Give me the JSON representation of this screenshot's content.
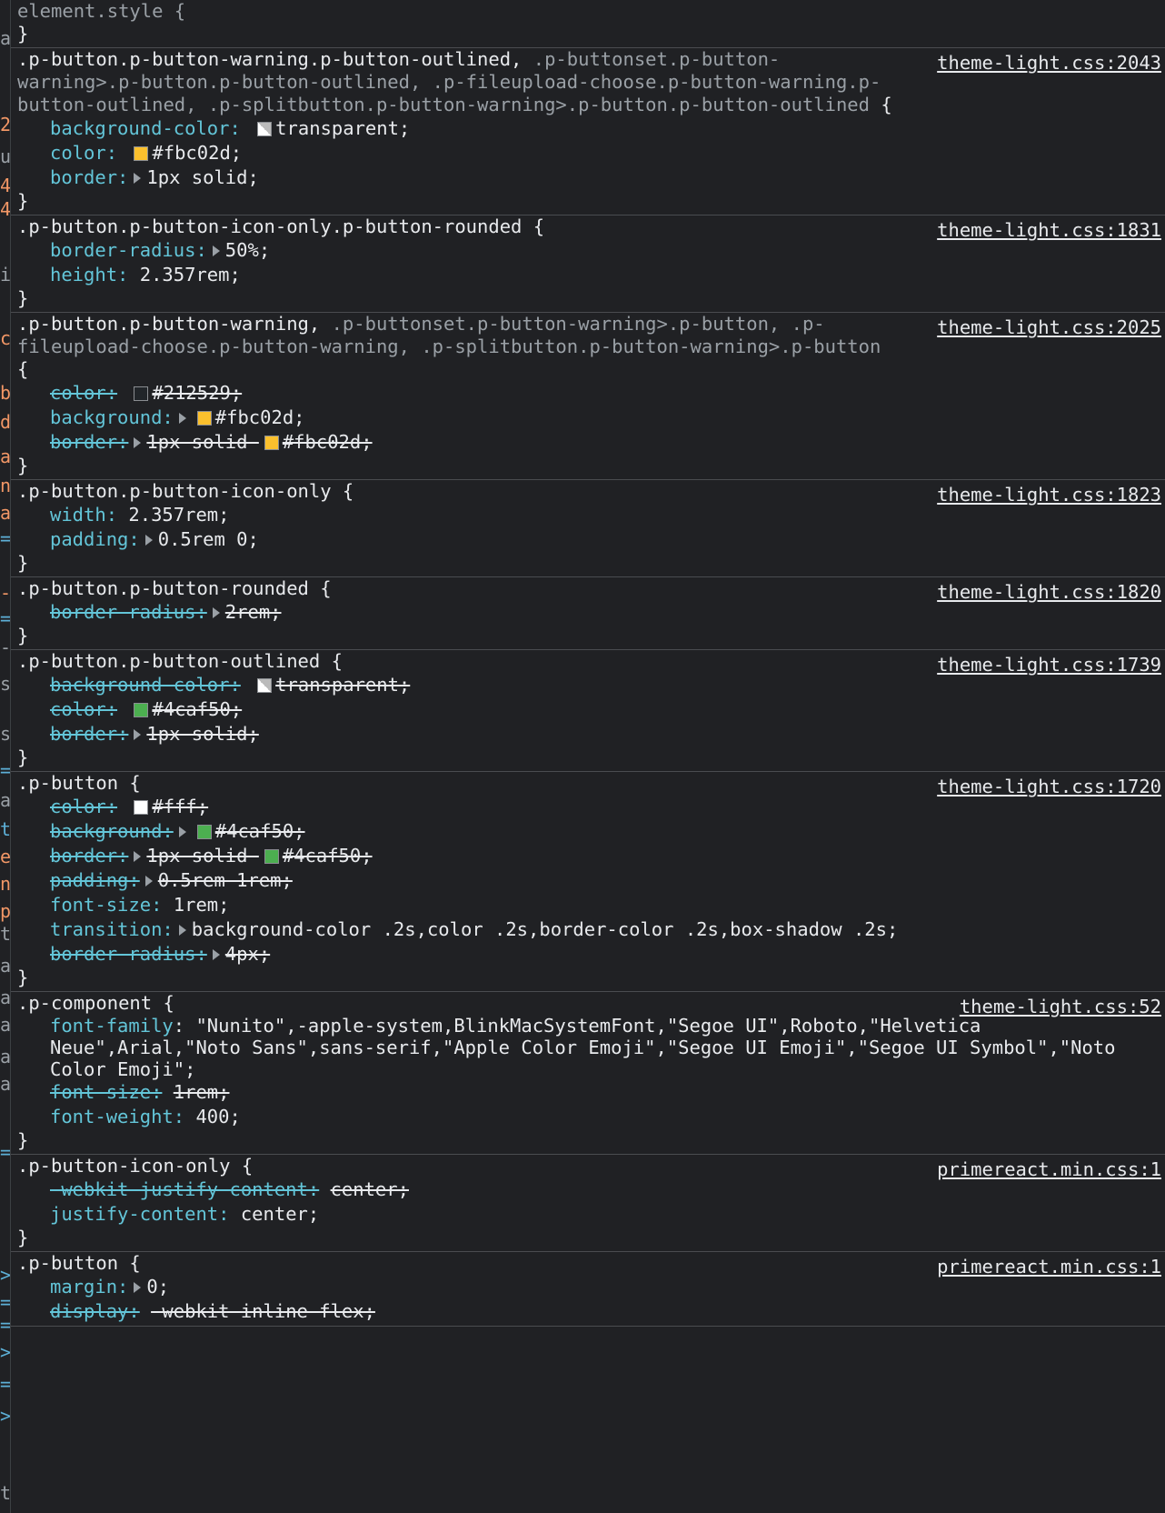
{
  "gutter_chars": [
    "a",
    "2",
    "u",
    "4",
    "4",
    "i",
    "c",
    "b",
    "d",
    "a",
    "n",
    "a",
    "=",
    "-",
    "=",
    "-",
    "s",
    "s",
    "=",
    "a",
    "t",
    "e",
    "n",
    "p",
    "t",
    "a",
    "a",
    "a",
    "a",
    "a",
    "=",
    ">",
    "=",
    "=",
    ">",
    "=",
    ">",
    "t"
  ],
  "element_style": {
    "selector": "element.style {",
    "close": "}"
  },
  "rules": [
    {
      "source": "theme-light.css:2043",
      "selector_main": ".p-button.p-button-warning.p-button-outlined, ",
      "selector_dim": ".p-buttonset.p-button-warning>.p-button.p-button-outlined, .p-fileupload-choose.p-button-warning.p-button-outlined, .p-splitbutton.p-button-warning>.p-button.p-button-outlined",
      "decls": [
        {
          "name": "background-color",
          "value": "transparent;",
          "swatch": "#ffffff",
          "tri": false,
          "off": false
        },
        {
          "name": "color",
          "value": "#fbc02d;",
          "swatch": "#fbc02d",
          "tri": false,
          "off": false
        },
        {
          "name": "border",
          "value": "1px solid;",
          "tri": true,
          "off": false
        }
      ]
    },
    {
      "source": "theme-light.css:1831",
      "selector_main": ".p-button.p-button-icon-only.p-button-rounded",
      "selector_dim": "",
      "decls": [
        {
          "name": "border-radius",
          "value": "50%;",
          "tri": true,
          "off": false
        },
        {
          "name": "height",
          "value": "2.357rem;",
          "tri": false,
          "off": false
        }
      ]
    },
    {
      "source": "theme-light.css:2025",
      "selector_main": ".p-button.p-button-warning, ",
      "selector_dim": ".p-buttonset.p-button-warning>.p-button, .p-fileupload-choose.p-button-warning, .p-splitbutton.p-button-warning>.p-button",
      "decls": [
        {
          "name": "color",
          "value": "#212529;",
          "swatch": "#212529",
          "tri": false,
          "off": true
        },
        {
          "name": "background",
          "value": "#fbc02d;",
          "swatch": "#fbc02d",
          "tri": true,
          "off": false
        },
        {
          "name": "border",
          "value": "1px solid ",
          "swatch2": "#fbc02d",
          "value2": "#fbc02d;",
          "tri": true,
          "off": true
        }
      ]
    },
    {
      "source": "theme-light.css:1823",
      "selector_main": ".p-button.p-button-icon-only",
      "selector_dim": "",
      "decls": [
        {
          "name": "width",
          "value": "2.357rem;",
          "tri": false,
          "off": false
        },
        {
          "name": "padding",
          "value": "0.5rem 0;",
          "tri": true,
          "off": false
        }
      ]
    },
    {
      "source": "theme-light.css:1820",
      "selector_main": ".p-button.p-button-rounded",
      "selector_dim": "",
      "decls": [
        {
          "name": "border-radius",
          "value": "2rem;",
          "tri": true,
          "off": true
        }
      ]
    },
    {
      "source": "theme-light.css:1739",
      "selector_main": ".p-button.p-button-outlined",
      "selector_dim": "",
      "decls": [
        {
          "name": "background-color",
          "value": "transparent;",
          "swatch": "#ffffff",
          "tri": false,
          "off": true
        },
        {
          "name": "color",
          "value": "#4caf50;",
          "swatch": "#4caf50",
          "tri": false,
          "off": true
        },
        {
          "name": "border",
          "value": "1px solid;",
          "tri": true,
          "off": true
        }
      ]
    },
    {
      "source": "theme-light.css:1720",
      "selector_main": ".p-button",
      "selector_dim": "",
      "decls": [
        {
          "name": "color",
          "value": "#fff;",
          "swatch": "#ffffff",
          "tri": false,
          "off": true
        },
        {
          "name": "background",
          "value": "#4caf50;",
          "swatch": "#4caf50",
          "tri": true,
          "off": true
        },
        {
          "name": "border",
          "value": "1px solid ",
          "swatch2": "#4caf50",
          "value2": "#4caf50;",
          "tri": true,
          "off": true
        },
        {
          "name": "padding",
          "value": "0.5rem 1rem;",
          "tri": true,
          "off": true
        },
        {
          "name": "font-size",
          "value": "1rem;",
          "tri": false,
          "off": false
        },
        {
          "name": "transition",
          "value": "background-color .2s,color .2s,border-color .2s,box-shadow .2s;",
          "tri": true,
          "off": false
        },
        {
          "name": "border-radius",
          "value": "4px;",
          "tri": true,
          "off": true
        }
      ]
    },
    {
      "source": "theme-light.css:52",
      "selector_main": ".p-component",
      "selector_dim": "",
      "font_family": "\"Nunito\",-apple-system,BlinkMacSystemFont,\"Segoe UI\",Roboto,\"Helvetica Neue\",Arial,\"Noto Sans\",sans-serif,\"Apple Color Emoji\",\"Segoe UI Emoji\",\"Segoe UI Symbol\",\"Noto Color Emoji\";",
      "decls": [
        {
          "name": "font-size",
          "value": "1rem;",
          "tri": false,
          "off": true
        },
        {
          "name": "font-weight",
          "value": "400;",
          "tri": false,
          "off": false
        }
      ]
    },
    {
      "source": "primereact.min.css:1",
      "selector_main": ".p-button-icon-only",
      "selector_dim": "",
      "decls": [
        {
          "name": "-webkit-justify-content",
          "value": "center;",
          "tri": false,
          "off": true
        },
        {
          "name": "justify-content",
          "value": "center;",
          "tri": false,
          "off": false
        }
      ]
    },
    {
      "source": "primereact.min.css:1",
      "selector_main": ".p-button",
      "selector_dim": "",
      "decls": [
        {
          "name": "margin",
          "value": "0;",
          "tri": true,
          "off": false
        },
        {
          "name": "display",
          "value": "-webkit-inline-flex;",
          "tri": false,
          "off": true
        }
      ]
    }
  ]
}
